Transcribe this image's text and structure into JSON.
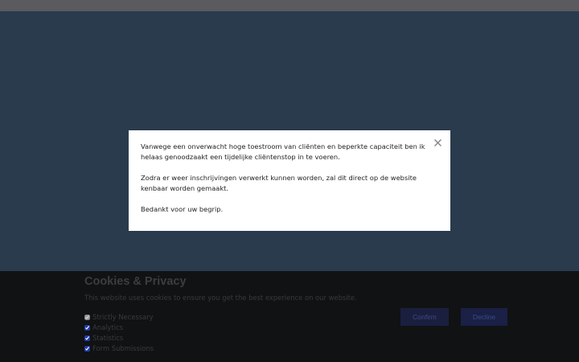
{
  "modal": {
    "paragraph1": "Vanwege een onverwacht hoge toestroom van cliënten en beperkte capaciteit ben ik helaas genoodzaakt een tijdelijke cliëntenstop in te voeren.",
    "paragraph2": "Zodra er weer inschrijvingen verwerkt kunnen worden, zal dit direct op de website kenbaar worden gemaakt.",
    "paragraph3": "Bedankt voor uw begrip.",
    "close_icon": "close-icon"
  },
  "cookie_banner": {
    "title": "Cookies & Privacy",
    "description": "This website uses cookies to ensure you get the best experience on our website.",
    "options": [
      {
        "label": "Strictly Necessary",
        "checked": true,
        "disabled": true
      },
      {
        "label": "Analytics",
        "checked": true,
        "disabled": false
      },
      {
        "label": "Statistics",
        "checked": true,
        "disabled": false
      },
      {
        "label": "Form Submissions",
        "checked": true,
        "disabled": false
      }
    ],
    "confirm_label": "Confirm",
    "decline_label": "Decline"
  },
  "colors": {
    "page_background": "#2a3b4d",
    "top_bar": "#5b5a5e",
    "modal_background": "#ffffff",
    "cookie_background": "#111213",
    "button_background": "#1a1f3f"
  }
}
